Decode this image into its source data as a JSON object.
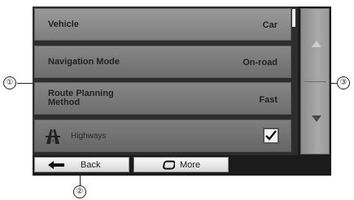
{
  "settings_list": {
    "rows": [
      {
        "label": "Vehicle",
        "value": "Car"
      },
      {
        "label": "Navigation Mode",
        "value": "On-road"
      },
      {
        "label_line1": "Route Planning",
        "label_line2": "Method",
        "value": "Fast"
      },
      {
        "label": "Highways",
        "checked": true,
        "icon": "highway-icon"
      }
    ]
  },
  "scroll": {
    "up_icon": "triangle-up-icon",
    "down_icon": "triangle-down-icon"
  },
  "bottom_bar": {
    "back_label": "Back",
    "back_icon": "arrow-left-icon",
    "more_label": "More",
    "more_icon": "rounded-rect-icon"
  },
  "callouts": {
    "list": "①",
    "back": "②",
    "scroll": "③"
  }
}
